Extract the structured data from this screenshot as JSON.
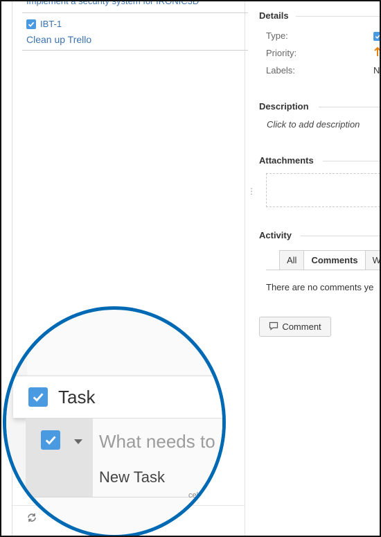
{
  "issue_list": {
    "cut_summary": "Implement a security system for IRONIC3D",
    "items": [
      {
        "key": "IBT-1",
        "summary": "Clean up Trello"
      }
    ]
  },
  "details": {
    "heading": "Details",
    "fields": [
      {
        "label": "Type:",
        "value": ""
      },
      {
        "label": "Priority:",
        "value": ""
      },
      {
        "label": "Labels:",
        "value": "N"
      }
    ]
  },
  "description": {
    "heading": "Description",
    "placeholder": "Click to add description"
  },
  "attachments": {
    "heading": "Attachments"
  },
  "activity": {
    "heading": "Activity",
    "tabs": [
      "All",
      "Comments",
      "W"
    ],
    "active_tab": "Comments",
    "empty_text": "There are no comments ye",
    "comment_button": "Comment"
  },
  "magnifier": {
    "type_label": "Task",
    "summary_placeholder": "What needs to",
    "new_item_text": "New Task",
    "cancel_cut": "cel",
    "more_label": "•••"
  },
  "colors": {
    "lens_border": "#0069b3",
    "checkbox": "#4a9ae1",
    "link": "#3b73af",
    "priority_arrow": "#e8820c"
  },
  "icons": [
    "checkbox-icon",
    "refresh-icon",
    "comment-icon",
    "priority-arrow-icon",
    "dropdown-caret-icon",
    "resize-handle-icon"
  ]
}
